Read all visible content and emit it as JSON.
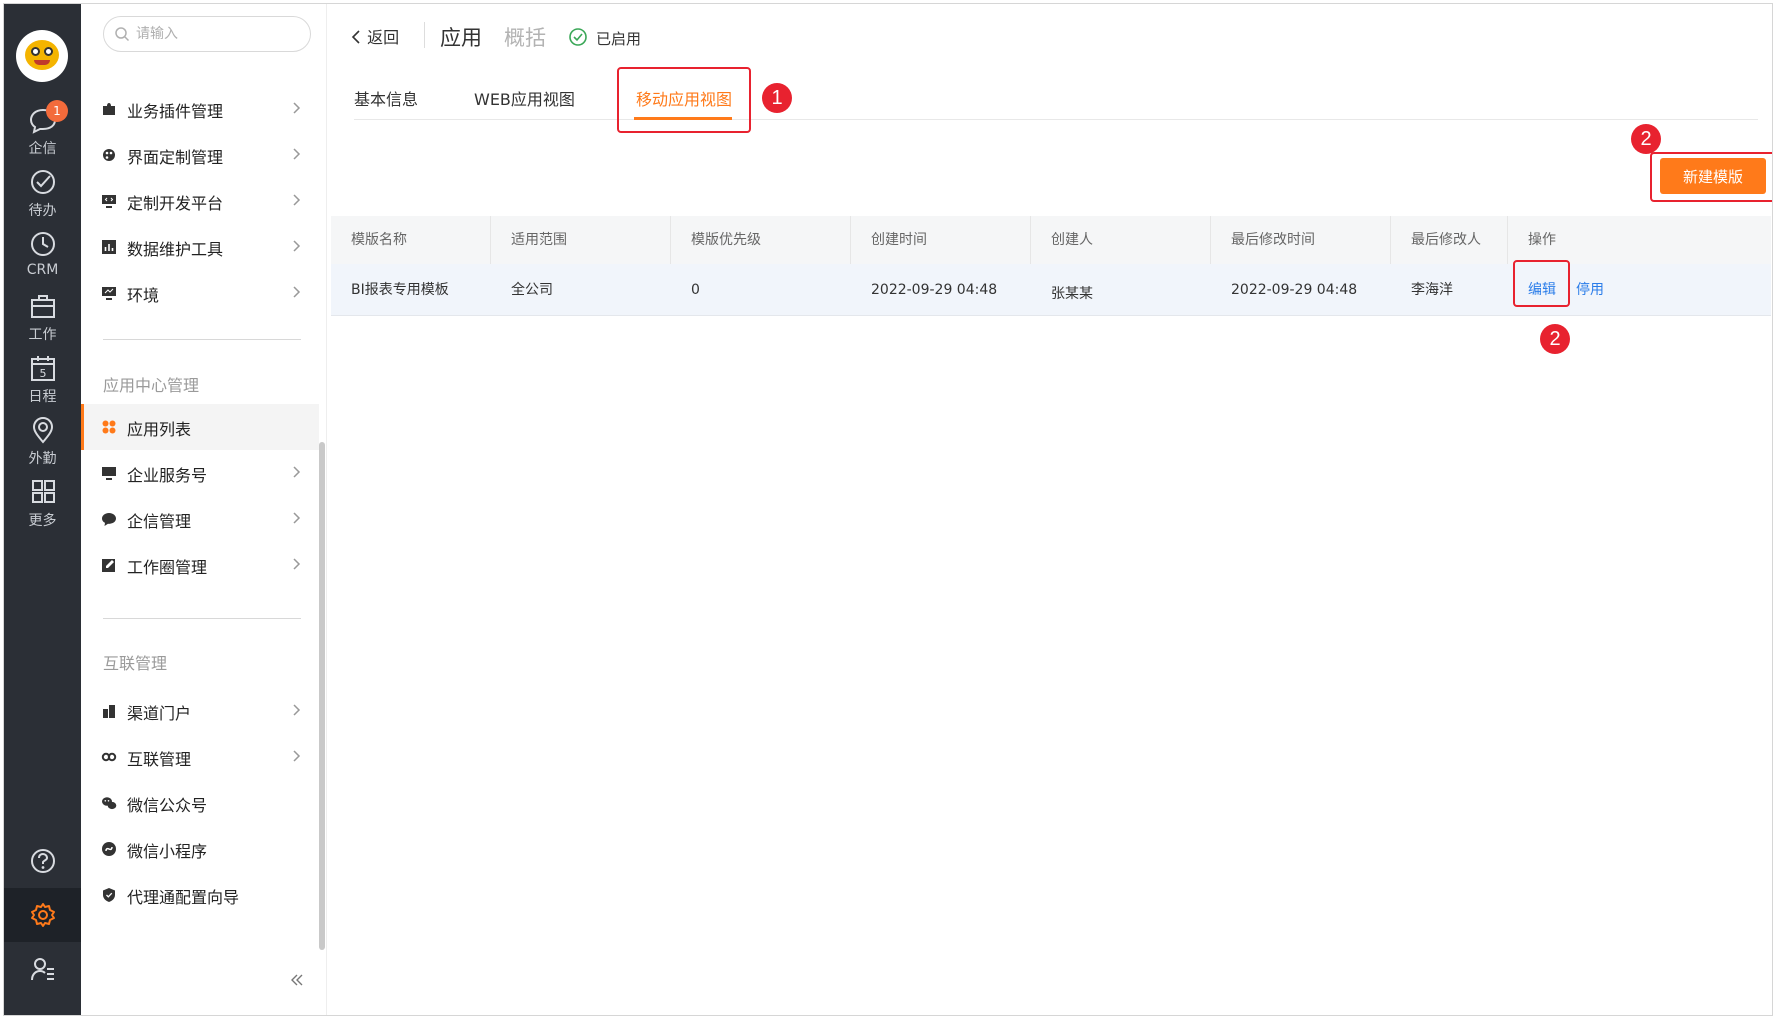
{
  "rail": {
    "items": [
      {
        "label": "企信",
        "icon": "chat-bubble-icon",
        "badge": "1"
      },
      {
        "label": "待办",
        "icon": "check-circle-icon"
      },
      {
        "label": "CRM",
        "icon": "clock-icon"
      },
      {
        "label": "工作",
        "icon": "briefcase-icon"
      },
      {
        "label": "日程",
        "icon": "calendar-icon",
        "day": "5"
      },
      {
        "label": "外勤",
        "icon": "location-pin-icon"
      },
      {
        "label": "更多",
        "icon": "grid-icon"
      }
    ]
  },
  "menu": {
    "search_placeholder": "请输入",
    "group1": [
      {
        "label": "业务插件管理",
        "icon": "puzzle-icon"
      },
      {
        "label": "界面定制管理",
        "icon": "palette-icon"
      },
      {
        "label": "定制开发平台",
        "icon": "monitor-code-icon"
      },
      {
        "label": "数据维护工具",
        "icon": "chart-box-icon"
      },
      {
        "label": "环境",
        "icon": "monitor-icon"
      }
    ],
    "section_app_center": "应用中心管理",
    "group2": [
      {
        "label": "应用列表",
        "icon": "apps-icon"
      },
      {
        "label": "企业服务号",
        "icon": "desktop-icon"
      },
      {
        "label": "企信管理",
        "icon": "message-icon"
      },
      {
        "label": "工作圈管理",
        "icon": "edit-icon"
      }
    ],
    "section_interconnect": "互联管理",
    "group3": [
      {
        "label": "渠道门户",
        "icon": "building-icon"
      },
      {
        "label": "互联管理",
        "icon": "link-icon"
      },
      {
        "label": "微信公众号",
        "icon": "wechat-icon"
      },
      {
        "label": "微信小程序",
        "icon": "mini-program-icon"
      },
      {
        "label": "代理通配置向导",
        "icon": "shield-icon"
      }
    ]
  },
  "header": {
    "back_label": "返回",
    "app_title": "应用",
    "overview_label": "概括",
    "status_label": "已启用"
  },
  "tabs": {
    "basic_info": "基本信息",
    "web_view": "WEB应用视图",
    "mobile_view": "移动应用视图"
  },
  "annotations": {
    "one": "1",
    "two": "2"
  },
  "actions": {
    "new_template": "新建模版"
  },
  "table": {
    "columns": [
      "模版名称",
      "适用范围",
      "模版优先级",
      "创建时间",
      "创建人",
      "最后修改时间",
      "最后修改人",
      "操作"
    ],
    "rows": [
      {
        "name": "BI报表专用模板",
        "scope": "全公司",
        "priority": "0",
        "created_at": "2022-09-29 04:48",
        "creator": "张某某",
        "modified_at": "2022-09-29 04:48",
        "modifier": "李海洋",
        "edit": "编辑",
        "disable": "停用"
      }
    ]
  },
  "colors": {
    "accent": "#ff7a1a",
    "link": "#2b7de9",
    "annotation": "#e8222f",
    "rail_bg": "#2b2f36"
  }
}
